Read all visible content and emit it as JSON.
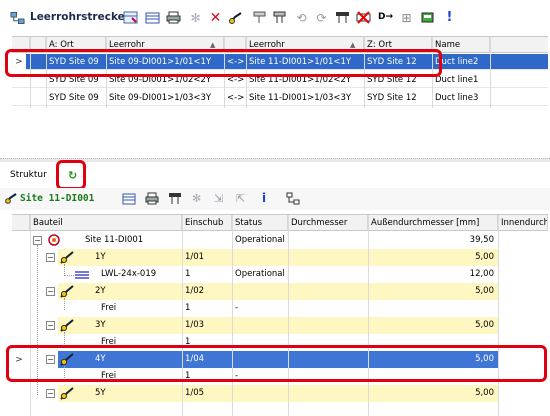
{
  "toolbar1": {
    "title": "Leerrohrstrecken",
    "icons": [
      "table-icon",
      "filter-icon",
      "export-icon",
      "print-icon",
      "asterisk-icon",
      "delete-icon",
      "route-icon",
      "connect-icon",
      "disconnect-icon",
      "split-icon",
      "merge-icon",
      "link-icon",
      "remove-icon",
      "forward-icon",
      "group-icon",
      "db-icon",
      "warning-icon"
    ]
  },
  "grid1": {
    "columns": [
      "A: Ort",
      "Leerrohr",
      "Leerrohr",
      "Z: Ort",
      "Name"
    ],
    "rows": [
      {
        "a_ort": "SYD Site 09",
        "leerrohr_a": "Site 09-DI001>1/01<1Y",
        "link": "<->",
        "leerrohr_z": "Site 11-DI001>1/01<1Y",
        "z_ort": "SYD Site 12",
        "name": "Duct line2"
      },
      {
        "a_ort": "SYD Site 09",
        "leerrohr_a": "Site 09-DI001>1/02<2Y",
        "link": "<->",
        "leerrohr_z": "Site 11-DI001>1/02<2Y",
        "z_ort": "SYD Site 12",
        "name": "Duct line1"
      },
      {
        "a_ort": "SYD Site 09",
        "leerrohr_a": "Site 09-DI001>1/03<3Y",
        "link": "<->",
        "leerrohr_z": "Site 11-DI001>1/03<3Y",
        "z_ort": "SYD Site 12",
        "name": "Duct line3"
      }
    ]
  },
  "structure": {
    "tab_label": "Struktur",
    "refresh_glyph": "↻",
    "site_label": "Site 11-DI001"
  },
  "grid2": {
    "columns": [
      "Bauteil",
      "Einschub",
      "Status",
      "Durchmesser",
      "Außendurchmesser [mm]",
      "Innendurch"
    ],
    "rows": [
      {
        "bauteil": "Site 11-DI001",
        "einschub": "",
        "status": "Operational",
        "durchmesser": "",
        "aussen": "39,50",
        "level": 0
      },
      {
        "bauteil": "1Y",
        "einschub": "1/01",
        "status": "",
        "durchmesser": "",
        "aussen": "5,00",
        "level": 1
      },
      {
        "bauteil": "LWL-24x-019",
        "einschub": "1",
        "status": "Operational",
        "durchmesser": "",
        "aussen": "12,00",
        "level": 2
      },
      {
        "bauteil": "2Y",
        "einschub": "1/02",
        "status": "",
        "durchmesser": "",
        "aussen": "5,00",
        "level": 1
      },
      {
        "bauteil": "Frei",
        "einschub": "1",
        "status": "-",
        "durchmesser": "",
        "aussen": "",
        "level": 2
      },
      {
        "bauteil": "3Y",
        "einschub": "1/03",
        "status": "",
        "durchmesser": "",
        "aussen": "5,00",
        "level": 1
      },
      {
        "bauteil": "Frei",
        "einschub": "1",
        "status": "",
        "durchmesser": "",
        "aussen": "",
        "level": 2
      },
      {
        "bauteil": "4Y",
        "einschub": "1/04",
        "status": "",
        "durchmesser": "",
        "aussen": "5,00",
        "level": 1
      },
      {
        "bauteil": "Frei",
        "einschub": "1",
        "status": "-",
        "durchmesser": "",
        "aussen": "",
        "level": 2
      },
      {
        "bauteil": "5Y",
        "einschub": "1/05",
        "status": "",
        "durchmesser": "",
        "aussen": "5,00",
        "level": 1
      }
    ]
  },
  "colors": {
    "selection": "#2f68c9",
    "highlight": "#e00010",
    "yellow_row": "#fff7c2"
  }
}
